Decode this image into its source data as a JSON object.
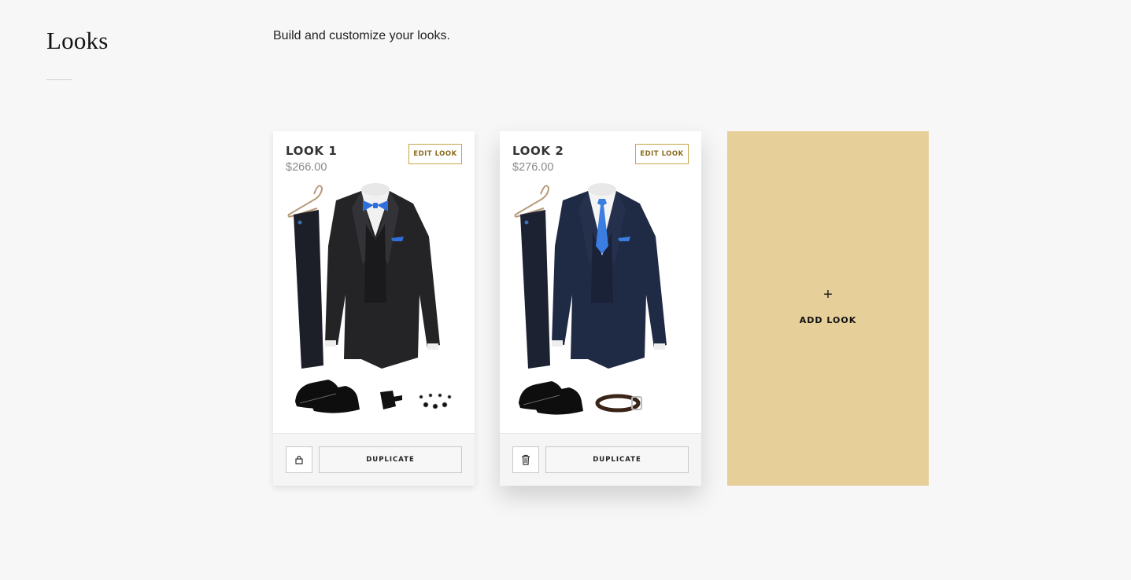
{
  "header": {
    "title": "Looks",
    "subtitle": "Build and customize your looks."
  },
  "looks": [
    {
      "name": "LOOK 1",
      "price": "$266.00",
      "edit_label": "EDIT LOOK",
      "duplicate_label": "DUPLICATE",
      "action_icon": "lock-icon",
      "jacket_color": "#232326",
      "accessory_color": "#2f6fdc",
      "accessory": "bow-tie",
      "extras": [
        "dress-shoes",
        "cummerbund",
        "cufflinks-studs"
      ]
    },
    {
      "name": "LOOK 2",
      "price": "$276.00",
      "edit_label": "EDIT LOOK",
      "duplicate_label": "DUPLICATE",
      "action_icon": "trash-icon",
      "jacket_color": "#1f2a44",
      "accessory_color": "#3b7de0",
      "accessory": "necktie",
      "extras": [
        "dress-shoes",
        "belt"
      ]
    }
  ],
  "add_look": {
    "icon": "plus-icon",
    "label": "ADD LOOK"
  },
  "colors": {
    "background": "#f7f7f7",
    "accent_gold": "#c9a24a",
    "add_card": "#e6cf98"
  }
}
